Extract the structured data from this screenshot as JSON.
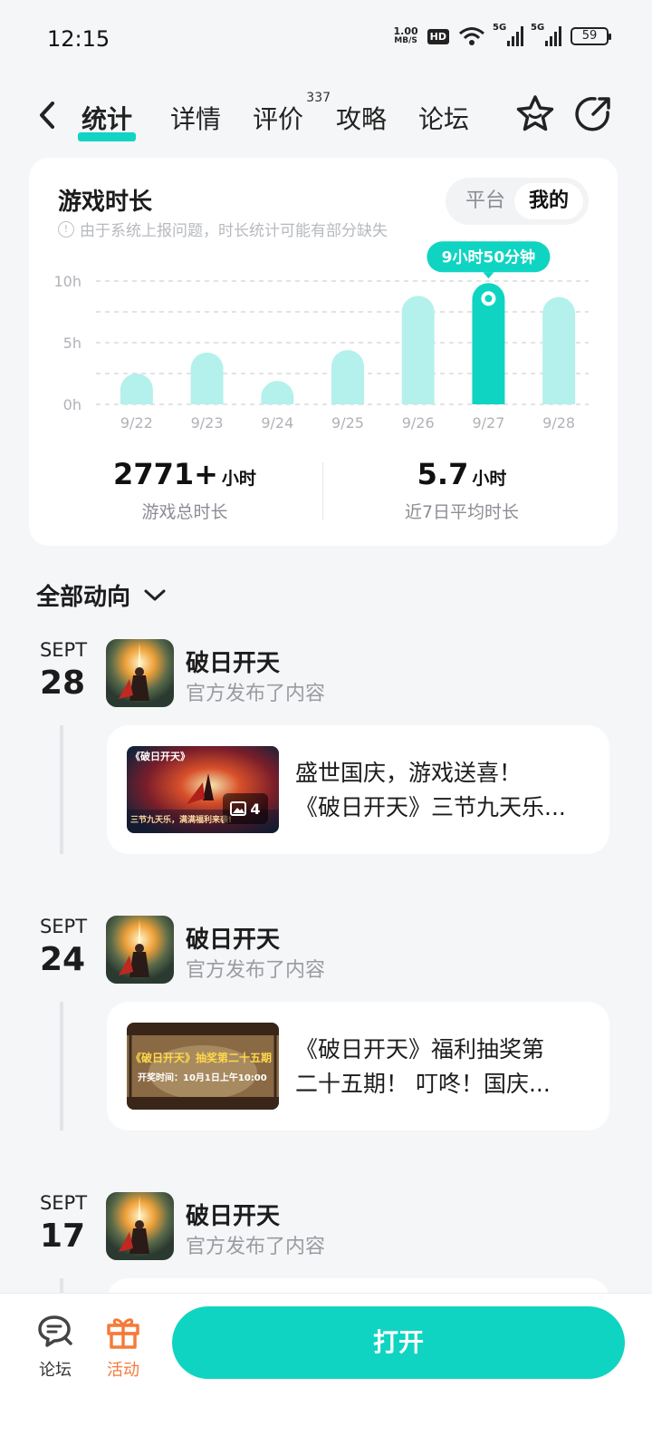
{
  "status_bar": {
    "time": "12:15",
    "net_speed_value": "1.00",
    "net_speed_unit": "MB/S",
    "hd": "HD",
    "sim1": "5G",
    "sim2": "5G",
    "battery": "59"
  },
  "nav": {
    "tabs": [
      {
        "label": "统计",
        "active": true
      },
      {
        "label": "详情"
      },
      {
        "label": "评价",
        "count": "337"
      },
      {
        "label": "攻略"
      },
      {
        "label": "论坛"
      }
    ]
  },
  "stats_card": {
    "title": "游戏时长",
    "note": "由于系统上报问题，时长统计可能有部分缺失",
    "toggle": {
      "platform": "平台",
      "mine": "我的"
    },
    "tooltip": "9小时50分钟",
    "total_value": "2771+",
    "total_unit": "小时",
    "total_label": "游戏总时长",
    "avg_value": "5.7",
    "avg_unit": "小时",
    "avg_label": "近7日平均时长"
  },
  "chart_data": {
    "type": "bar",
    "categories": [
      "9/22",
      "9/23",
      "9/24",
      "9/25",
      "9/26",
      "9/27",
      "9/28"
    ],
    "values": [
      2.5,
      4.2,
      1.9,
      4.4,
      8.8,
      9.83,
      8.7
    ],
    "y_ticks": [
      "0h",
      "5h",
      "10h"
    ],
    "ylim": [
      0,
      10
    ],
    "highlight_index": 5,
    "colors": {
      "bar": "#b4f1ec",
      "highlight": "#10d4c2",
      "grid": "#d9dadd"
    }
  },
  "feed": {
    "header": "全部动向",
    "entries": [
      {
        "month": "SEPT",
        "day": "28",
        "game": "破日开天",
        "action": "官方发布了内容",
        "post_line1": "盛世国庆，游戏送喜！",
        "post_line2": "《破日开天》三节九天乐...",
        "thumb_title": "《破日开天》",
        "thumb_caption": "三节九天乐，满满福利来袭!",
        "image_count": "4"
      },
      {
        "month": "SEPT",
        "day": "24",
        "game": "破日开天",
        "action": "官方发布了内容",
        "post_line1": "《破日开天》福利抽奖第",
        "post_line2": "二十五期！ 叮咚！国庆...",
        "thumb_title": "《破日开天》抽奖第二十五期",
        "thumb_caption": "开奖时间：10月1日上午10:00"
      },
      {
        "month": "SEPT",
        "day": "17",
        "game": "破日开天",
        "action": "官方发布了内容"
      }
    ]
  },
  "bottom_bar": {
    "forum": "论坛",
    "activity": "活动",
    "open": "打开"
  }
}
